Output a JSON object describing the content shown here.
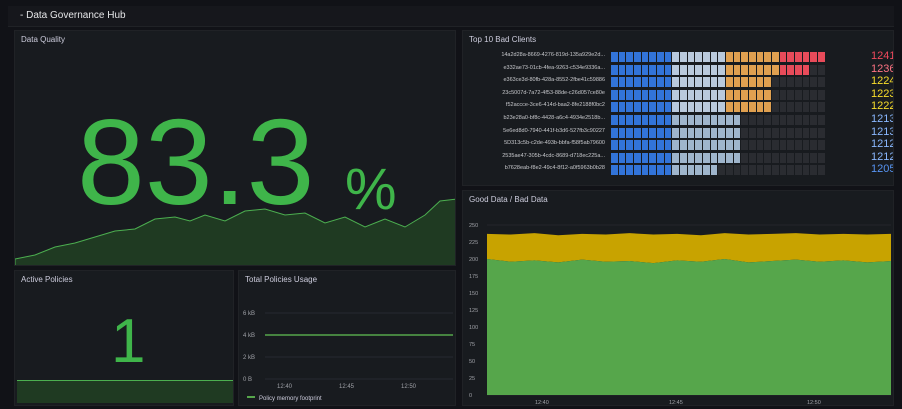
{
  "header": {
    "title": "- Data Governance Hub"
  },
  "panels": {
    "quality": {
      "title": "Data Quality",
      "value": "83.3",
      "unit": "%"
    },
    "policies": {
      "title": "Active Policies",
      "value": "1"
    },
    "usage": {
      "title": "Total Policies Usage",
      "y_ticks": [
        "6 kB",
        "4 kB",
        "2 kB",
        "0 B"
      ],
      "x_ticks": [
        "12:40",
        "12:45",
        "12:50"
      ],
      "legend": "Policy memory footprint"
    },
    "clients": {
      "title": "Top 10 Bad Clients",
      "rows": [
        {
          "id": "14a2d28a-8669-4276-819d-135a929e2d...",
          "value": "1241",
          "color": "#f2495c"
        },
        {
          "id": "e332ae73-01cb-4fea-9263-c534e9336a...",
          "value": "1236",
          "color": "#ff7383"
        },
        {
          "id": "e363ce3d-80fb-428a-8552-2fbe41c59886",
          "value": "1224",
          "color": "#fade2a"
        },
        {
          "id": "23c5007d-7a72-4f53-88de-c26d057ce80e",
          "value": "1223",
          "color": "#fade2a"
        },
        {
          "id": "f52accce-3ce6-414d-baa2-8fe2188f0bc2",
          "value": "1222",
          "color": "#fade2a"
        },
        {
          "id": "b23e28a0-bf8c-4428-a6c4-4934e2518b...",
          "value": "1213",
          "color": "#8ab8ff"
        },
        {
          "id": "5e6ed8d0-7940-441f-b3d6-527fb3c90227",
          "value": "1213",
          "color": "#8ab8ff"
        },
        {
          "id": "5D313c5b-c2de-493b-bbfa-f58f5ab79600",
          "value": "1212",
          "color": "#8ab8ff"
        },
        {
          "id": "2535ae47-305b-4cdc-8689-d718ec225a...",
          "value": "1212",
          "color": "#8ab8ff"
        },
        {
          "id": "b7628eab-f8e2-49c4-8f12-a0f5963b0b28",
          "value": "1205",
          "color": "#5794f2"
        }
      ]
    },
    "goodbad": {
      "title": "Good Data / Bad Data",
      "y_ticks": [
        "250",
        "225",
        "200",
        "175",
        "150",
        "125",
        "100",
        "75",
        "50",
        "25",
        "0"
      ],
      "x_ticks": [
        "12:40",
        "12:45",
        "12:50"
      ]
    }
  },
  "colors": {
    "good": "#56a64b",
    "bad": "#c8a300",
    "stat": "#3fb54a",
    "bg": "#181b1f"
  },
  "chart_data": [
    {
      "type": "area",
      "title": "Good Data / Bad Data",
      "ylim": [
        0,
        250
      ],
      "x": [
        "12:36",
        "12:37",
        "12:38",
        "12:39",
        "12:40",
        "12:41",
        "12:42",
        "12:43",
        "12:44",
        "12:45",
        "12:46",
        "12:47",
        "12:48",
        "12:49",
        "12:50",
        "12:51",
        "12:52",
        "12:53"
      ],
      "series": [
        {
          "values": [
            200,
            196,
            198,
            195,
            199,
            196,
            197,
            194,
            198,
            196,
            200,
            195,
            197,
            199,
            196,
            198,
            195,
            197
          ]
        },
        {
          "values": [
            237,
            236,
            238,
            235,
            237,
            236,
            238,
            236,
            237,
            235,
            238,
            236,
            237,
            238,
            236,
            237,
            236,
            237
          ]
        }
      ]
    }
  ]
}
